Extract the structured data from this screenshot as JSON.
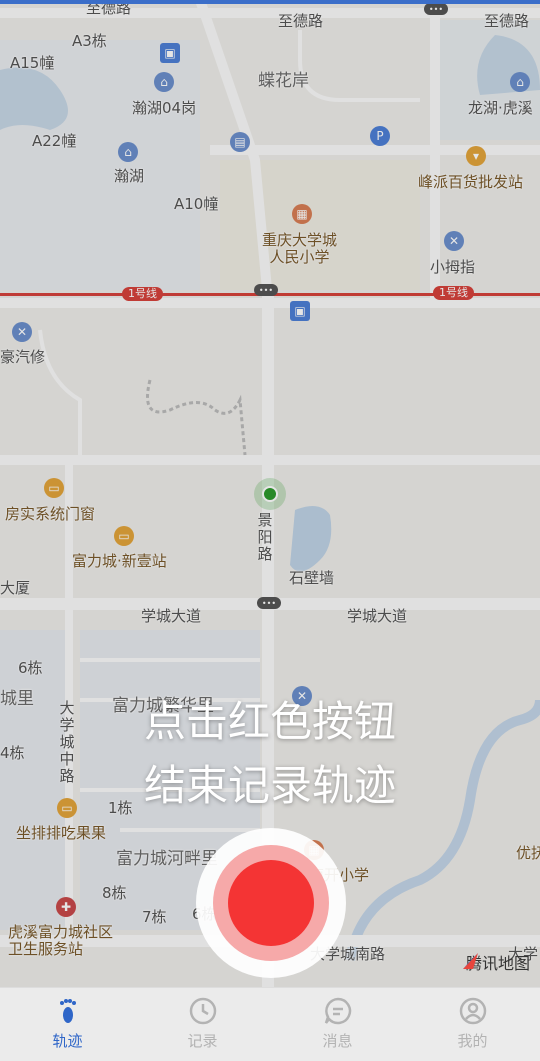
{
  "map": {
    "labels": {
      "zhide_left": "至德路",
      "zhide_mid": "至德路",
      "zhide_right": "至德路",
      "a3": "A3栋",
      "a15": "A15幢",
      "a22": "A22幢",
      "a10": "A10幢",
      "hanhu04": "瀚湖04岗",
      "hanhu": "瀚湖",
      "diehua": "蝶花岸",
      "longhu": "龙湖·虎溪",
      "fengpai": "峰派百货批发站",
      "cqu_school": "重庆大学城\n人民小学",
      "xiaomuzhi": "小拇指",
      "haoqi": "豪汽修",
      "fangshi": "房实系统门窗",
      "fuli_xinyi": "富力城·新壹站",
      "dasha": "大厦",
      "shibiqiang": "石壁墙",
      "jingyang": "景阳路",
      "xuecheng_left": "学城大道",
      "xuecheng_right": "学城大道",
      "b6": "6栋",
      "chengli": "城里",
      "b4": "4栋",
      "dxz": "大学城中路",
      "fuli_fanhua": "富力城繁华里",
      "b1": "1栋",
      "zuopai": "坐排排吃果果",
      "fuli_hepan": "富力城河畔里",
      "b8": "8栋",
      "b7": "7栋",
      "b6b": "6栋",
      "huxi_clinic": "虎溪富力城社区\n卫生服务站",
      "nankai": "南开小学",
      "dxcnan": "大学城南路",
      "youfu": "优抚",
      "daxue_r": "大学",
      "line1_left": "1号线",
      "line1_right": "1号线"
    },
    "watermark": "腾讯地图"
  },
  "hint": {
    "line1": "点击红色按钮",
    "line2": "结束记录轨迹"
  },
  "colors": {
    "accent": "#2f66c8",
    "record": "#f43434",
    "metro": "#d6423c"
  },
  "tabs": [
    {
      "label": "轨迹",
      "icon": "footprint-icon",
      "active": true
    },
    {
      "label": "记录",
      "icon": "clock-icon",
      "active": false
    },
    {
      "label": "消息",
      "icon": "message-icon",
      "active": false
    },
    {
      "label": "我的",
      "icon": "user-icon",
      "active": false
    }
  ]
}
